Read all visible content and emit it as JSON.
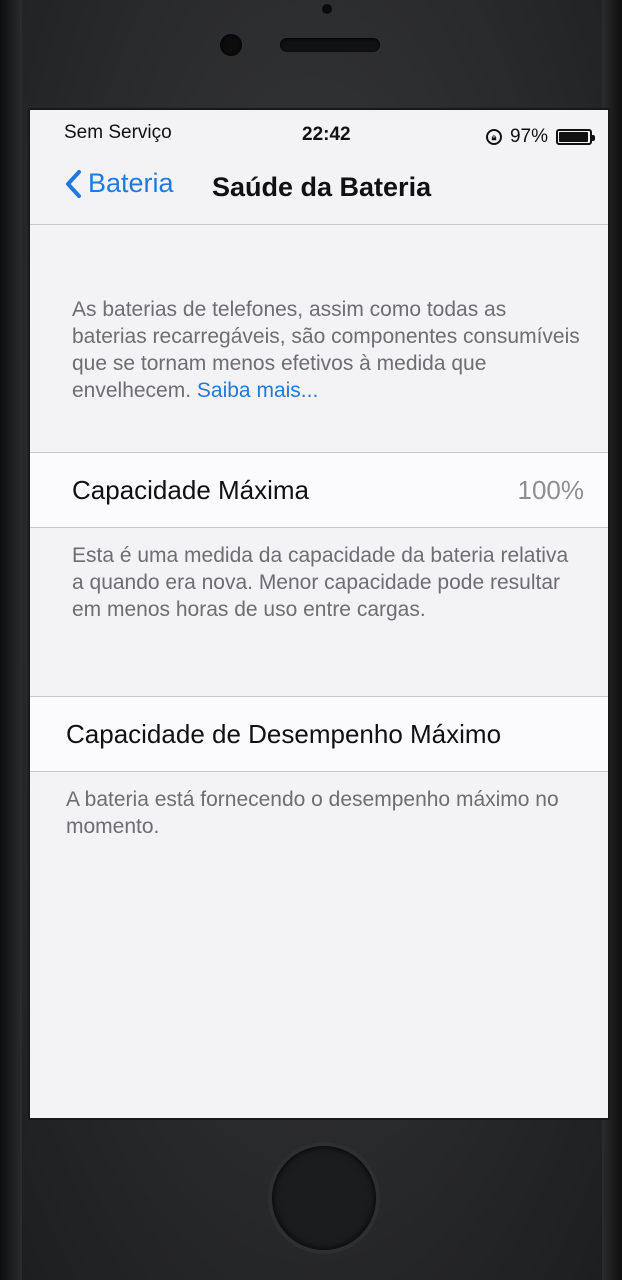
{
  "status_bar": {
    "carrier": "Sem Serviço",
    "time": "22:42",
    "battery_percent": "97%",
    "battery_level": 0.97
  },
  "nav": {
    "back_label": "Bateria",
    "title": "Saúde da Bateria"
  },
  "intro": {
    "text": "As baterias de telefones, assim como todas as baterias recarregáveis, são componentes consumíveis que se tornam menos efetivos à medida que envelhecem. ",
    "link_label": "Saiba mais..."
  },
  "max_capacity": {
    "label": "Capacidade Máxima",
    "value": "100%",
    "description": "Esta é uma medida da capacidade da bateria relativa a quando era nova. Menor capacidade pode resultar em menos horas de uso entre cargas."
  },
  "peak_performance": {
    "label": "Capacidade de Desempenho Máximo",
    "description": "A bateria está fornecendo o desempenho máximo no momento."
  },
  "icons": {
    "back": "chevron-left-icon",
    "rotation_lock": "rotation-lock-icon",
    "battery": "battery-icon"
  },
  "colors": {
    "accent": "#1f7ae0",
    "screen_background": "#f3f3f6",
    "secondary_text": "#6d6d72"
  }
}
